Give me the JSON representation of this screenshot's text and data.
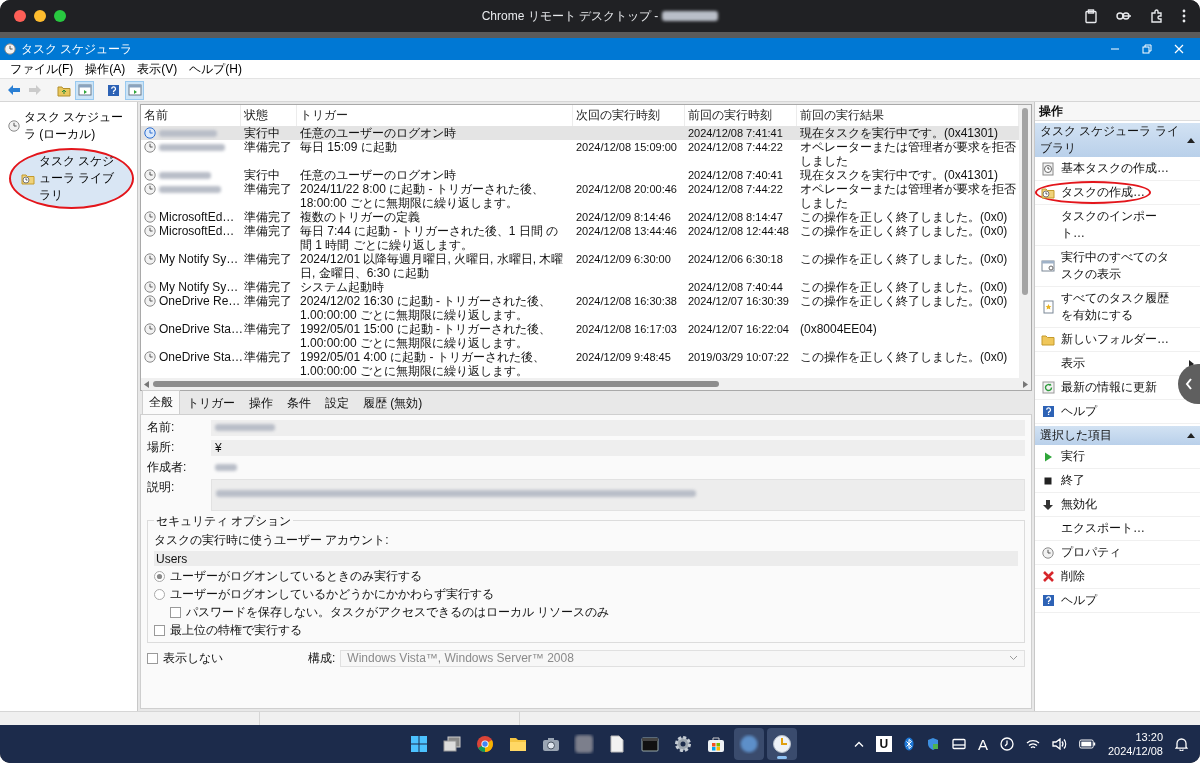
{
  "chrome": {
    "title": "Chrome リモート デスクトップ -",
    "host_redacted": true
  },
  "window": {
    "title": "タスク スケジューラ"
  },
  "menu": [
    "ファイル(F)",
    "操作(A)",
    "表示(V)",
    "ヘルプ(H)"
  ],
  "toolbar": [
    {
      "disabled": false,
      "on": false
    },
    {
      "disabled": true,
      "on": false
    },
    {
      "disabled": false,
      "on": false
    },
    {
      "disabled": false,
      "on": true
    },
    {
      "disabled": false,
      "on": false
    },
    {
      "disabled": false,
      "on": true
    }
  ],
  "tree": [
    {
      "label": "タスク スケジューラ (ローカル)",
      "selected": false,
      "circled": false,
      "children": [
        {
          "label": "タスク スケジューラ ライブラリ",
          "selected": true,
          "circled": true
        }
      ]
    }
  ],
  "table": {
    "columns": [
      "名前",
      "状態",
      "トリガー",
      "次回の実行時刻",
      "前回の実行時刻",
      "前回の実行結果"
    ],
    "rows": [
      {
        "redacted": true,
        "status": "実行中",
        "trigger": "任意のユーザーのログオン時",
        "last_run": "2024/12/08 7:41:41",
        "result": "現在タスクを実行中です。(0x41301)",
        "selected": true
      },
      {
        "redacted": true,
        "status": "準備完了",
        "trigger": "毎日 15:09 に起動",
        "next_run": "2024/12/08 15:09:00",
        "last_run": "2024/12/08 7:44:22",
        "result": "オペレーターまたは管理者が要求を拒否しました",
        "selected": false
      },
      {
        "redacted": true,
        "status": "実行中",
        "trigger": "任意のユーザーのログオン時",
        "last_run": "2024/12/08 7:40:41",
        "result": "現在タスクを実行中です。(0x41301)",
        "selected": false
      },
      {
        "redacted": true,
        "status": "準備完了",
        "trigger": "2024/11/22 8:00 に起動 - トリガーされた後、18:00:00 ごとに無期限に繰り返します。",
        "next_run": "2024/12/08 20:00:46",
        "last_run": "2024/12/08 7:44:22",
        "result": "オペレーターまたは管理者が要求を拒否しました",
        "selected": false
      },
      {
        "redacted": false,
        "name": "MicrosoftEd…",
        "status": "準備完了",
        "trigger": "複数のトリガーの定義",
        "next_run": "2024/12/09 8:14:46",
        "last_run": "2024/12/08 8:14:47",
        "result": "この操作を正しく終了しました。(0x0)",
        "selected": false
      },
      {
        "redacted": false,
        "name": "MicrosoftEd…",
        "status": "準備完了",
        "trigger": "毎日 7:44 に起動 - トリガーされた後、1 日間 の間 1 時間 ごとに繰り返します。",
        "next_run": "2024/12/08 13:44:46",
        "last_run": "2024/12/08 12:44:48",
        "result": "この操作を正しく終了しました。(0x0)",
        "selected": false
      },
      {
        "redacted": false,
        "name": "My Notify Sy…",
        "status": "準備完了",
        "trigger": "2024/12/01 以降毎週月曜日, 火曜日, 水曜日, 木曜日, 金曜日、6:30 に起動",
        "next_run": "2024/12/09 6:30:00",
        "last_run": "2024/12/06 6:30:18",
        "result": "この操作を正しく終了しました。(0x0)",
        "selected": false
      },
      {
        "redacted": false,
        "name": "My Notify Sy…",
        "status": "準備完了",
        "trigger": "システム起動時",
        "last_run": "2024/12/08 7:40:44",
        "result": "この操作を正しく終了しました。(0x0)",
        "selected": false
      },
      {
        "redacted": false,
        "name": "OneDrive Re…",
        "status": "準備完了",
        "trigger": "2024/12/02 16:30 に起動 - トリガーされた後、1.00:00:00 ごとに無期限に繰り返します。",
        "next_run": "2024/12/08 16:30:38",
        "last_run": "2024/12/07 16:30:39",
        "result": "この操作を正しく終了しました。(0x0)",
        "selected": false
      },
      {
        "redacted": false,
        "name": "OneDrive Sta…",
        "status": "準備完了",
        "trigger": "1992/05/01 15:00 に起動 - トリガーされた後、1.00:00:00 ごとに無期限に繰り返します。",
        "next_run": "2024/12/08 16:17:03",
        "last_run": "2024/12/07 16:22:04",
        "result": "(0x8004EE04)",
        "selected": false
      },
      {
        "redacted": false,
        "name": "OneDrive Sta…",
        "status": "準備完了",
        "trigger": "1992/05/01 4:00 に起動 - トリガーされた後、1.00:00:00 ごとに無期限に繰り返します。",
        "next_run": "2024/12/09 9:48:45",
        "last_run": "2019/03/29 10:07:22",
        "result": "この操作を正しく終了しました。(0x0)",
        "selected": false
      }
    ]
  },
  "detail": {
    "tabs": [
      {
        "label": "全般",
        "selected": true
      },
      {
        "label": "トリガー",
        "selected": false
      },
      {
        "label": "操作",
        "selected": false
      },
      {
        "label": "条件",
        "selected": false
      },
      {
        "label": "設定",
        "selected": false
      },
      {
        "label": "履歴 (無効)",
        "selected": false
      }
    ],
    "fields": [
      {
        "kind": "field",
        "label": "名前:",
        "redacted": true
      },
      {
        "kind": "field",
        "label": "場所:",
        "redacted": false,
        "value": "¥"
      },
      {
        "kind": "text",
        "label": "作成者:",
        "redacted": true
      },
      {
        "kind": "box",
        "label": "説明:",
        "redacted": true
      }
    ],
    "security": {
      "title": "セキュリティ オプション",
      "account_label": "タスクの実行時に使うユーザー アカウント:",
      "account": "Users",
      "options": [
        {
          "kind": "radio",
          "label": "ユーザーがログオンしているときのみ実行する",
          "selected": true
        },
        {
          "kind": "radio",
          "label": "ユーザーがログオンしているかどうかにかかわらず実行する",
          "selected": false,
          "children": [
            {
              "kind": "checkbox",
              "label": "パスワードを保存しない。タスクがアクセスできるのはローカル リソースのみ",
              "checked": false
            }
          ]
        },
        {
          "kind": "checkbox",
          "label": "最上位の特権で実行する",
          "checked": false
        }
      ]
    },
    "hidden_option": {
      "label": "表示しない",
      "checked": false
    },
    "configure": {
      "label": "構成:",
      "value": "Windows Vista™, Windows Server™ 2008",
      "disabled": true
    }
  },
  "actions": {
    "title": "操作",
    "sections": [
      {
        "title": "タスク スケジューラ ライブラリ",
        "expanded": true,
        "items": [
          {
            "label": "基本タスクの作成…",
            "circled": false,
            "submenu": false
          },
          {
            "label": "タスクの作成…",
            "circled": true,
            "submenu": false
          },
          {
            "label": "タスクのインポート…",
            "circled": false,
            "submenu": false
          },
          {
            "label": "実行中のすべてのタスクの表示",
            "circled": false,
            "submenu": false
          },
          {
            "label": "すべてのタスク履歴を有効にする",
            "circled": false,
            "submenu": false
          },
          {
            "label": "新しいフォルダー…",
            "circled": false,
            "submenu": false
          },
          {
            "label": "表示",
            "circled": false,
            "submenu": true
          },
          {
            "label": "最新の情報に更新",
            "circled": false,
            "submenu": false
          },
          {
            "label": "ヘルプ",
            "circled": false,
            "submenu": false
          }
        ]
      },
      {
        "title": "選択した項目",
        "expanded": true,
        "items": [
          {
            "label": "実行",
            "circled": false,
            "submenu": false
          },
          {
            "label": "終了",
            "circled": false,
            "submenu": false
          },
          {
            "label": "無効化",
            "circled": false,
            "submenu": false
          },
          {
            "label": "エクスポート…",
            "circled": false,
            "submenu": false
          },
          {
            "label": "プロパティ",
            "circled": false,
            "submenu": false
          },
          {
            "label": "削除",
            "circled": false,
            "submenu": false
          },
          {
            "label": "ヘルプ",
            "circled": false,
            "submenu": false
          }
        ]
      }
    ]
  },
  "taskbar": {
    "apps": [
      {
        "highlighted": false,
        "active": false
      },
      {
        "highlighted": false,
        "active": false
      },
      {
        "highlighted": false,
        "active": false
      },
      {
        "highlighted": false,
        "active": false
      },
      {
        "highlighted": false,
        "active": false
      },
      {
        "highlighted": false,
        "active": false
      },
      {
        "highlighted": false,
        "active": false
      },
      {
        "highlighted": false,
        "active": false
      },
      {
        "highlighted": false,
        "active": false
      },
      {
        "highlighted": false,
        "active": false
      },
      {
        "highlighted": true,
        "active": false
      },
      {
        "highlighted": true,
        "active": true
      }
    ],
    "app_letter": "U",
    "ime": "A",
    "time": "13:20",
    "date": "2024/12/08"
  }
}
